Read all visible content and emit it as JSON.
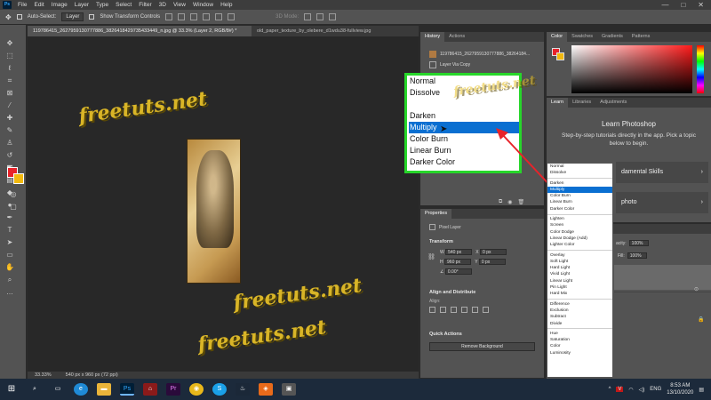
{
  "menubar": {
    "logo": "Ps",
    "items": [
      "File",
      "Edit",
      "Image",
      "Layer",
      "Type",
      "Select",
      "Filter",
      "3D",
      "View",
      "Window",
      "Help"
    ]
  },
  "options": {
    "auto_select_label": "Auto-Select:",
    "auto_select_target": "Layer",
    "show_transform": "Show Transform Controls",
    "mode_3d": "3D Mode:"
  },
  "doc_tabs": [
    "119786415_2627959130777886_3826418429735433449_n.jpg @ 33.3% (Layer 2, RGB/8#) *",
    "old_paper_texture_by_olebere_d1wdu38-fullview.jpg"
  ],
  "status": {
    "zoom": "33.33%",
    "dimensions": "540 px x 960 px (72 ppi)"
  },
  "watermark": "freetuts.net",
  "history": {
    "tabs": [
      "History",
      "Actions"
    ],
    "rows": [
      "119786415_2627959130777886_38264184...",
      "Layer Via Copy"
    ]
  },
  "properties": {
    "tab": "Properties",
    "layer_type": "Pixel Layer",
    "transform_title": "Transform",
    "w_label": "W",
    "w_value": "540 px",
    "h_label": "H",
    "h_value": "960 px",
    "x_label": "X",
    "x_value": "0 px",
    "y_label": "Y",
    "y_value": "0 px",
    "angle": "0.00°",
    "align_title": "Align and Distribute",
    "align_label": "Align:",
    "quick_title": "Quick Actions",
    "remove_bg": "Remove Background"
  },
  "color_panel": {
    "tabs": [
      "Color",
      "Swatches",
      "Gradients",
      "Patterns"
    ]
  },
  "learn_panel": {
    "tabs": [
      "Learn",
      "Libraries",
      "Adjustments"
    ],
    "title": "Learn Photoshop",
    "description": "Step-by-step tutorials directly in the app. Pick a topic below to begin.",
    "card1": "damental Skills",
    "card2": "photo"
  },
  "layers_panel": {
    "opacity_label": "acity:",
    "opacity_value": "100%",
    "fill_label": "Fill:",
    "fill_value": "100%"
  },
  "zoom_menu": {
    "group1": [
      "Normal",
      "Dissolve"
    ],
    "group2": [
      "Darken",
      "Multiply",
      "Color Burn",
      "Linear Burn",
      "Darker Color"
    ],
    "highlighted": "Multiply"
  },
  "blend_list": {
    "groups": [
      [
        "Normal",
        "Dissolve"
      ],
      [
        "Darken",
        "Multiply",
        "Color Burn",
        "Linear Burn",
        "Darker Color"
      ],
      [
        "Lighten",
        "Screen",
        "Color Dodge",
        "Linear Dodge (Add)",
        "Lighter Color"
      ],
      [
        "Overlay",
        "Soft Light",
        "Hard Light",
        "Vivid Light",
        "Linear Light",
        "Pin Light",
        "Hard Mix"
      ],
      [
        "Difference",
        "Exclusion",
        "Subtract",
        "Divide"
      ],
      [
        "Hue",
        "Saturation",
        "Color",
        "Luminosity"
      ]
    ],
    "highlighted": "Multiply"
  },
  "taskbar": {
    "time": "8:53 AM",
    "date": "13/10/2020",
    "lang": "ENG"
  },
  "colors": {
    "highlight": "#0a6fd1",
    "callout_border": "#27d62a",
    "arrow": "#e8232a",
    "watermark": "#e8c227",
    "foreground": "#e8232a",
    "background": "#f2b90f"
  }
}
